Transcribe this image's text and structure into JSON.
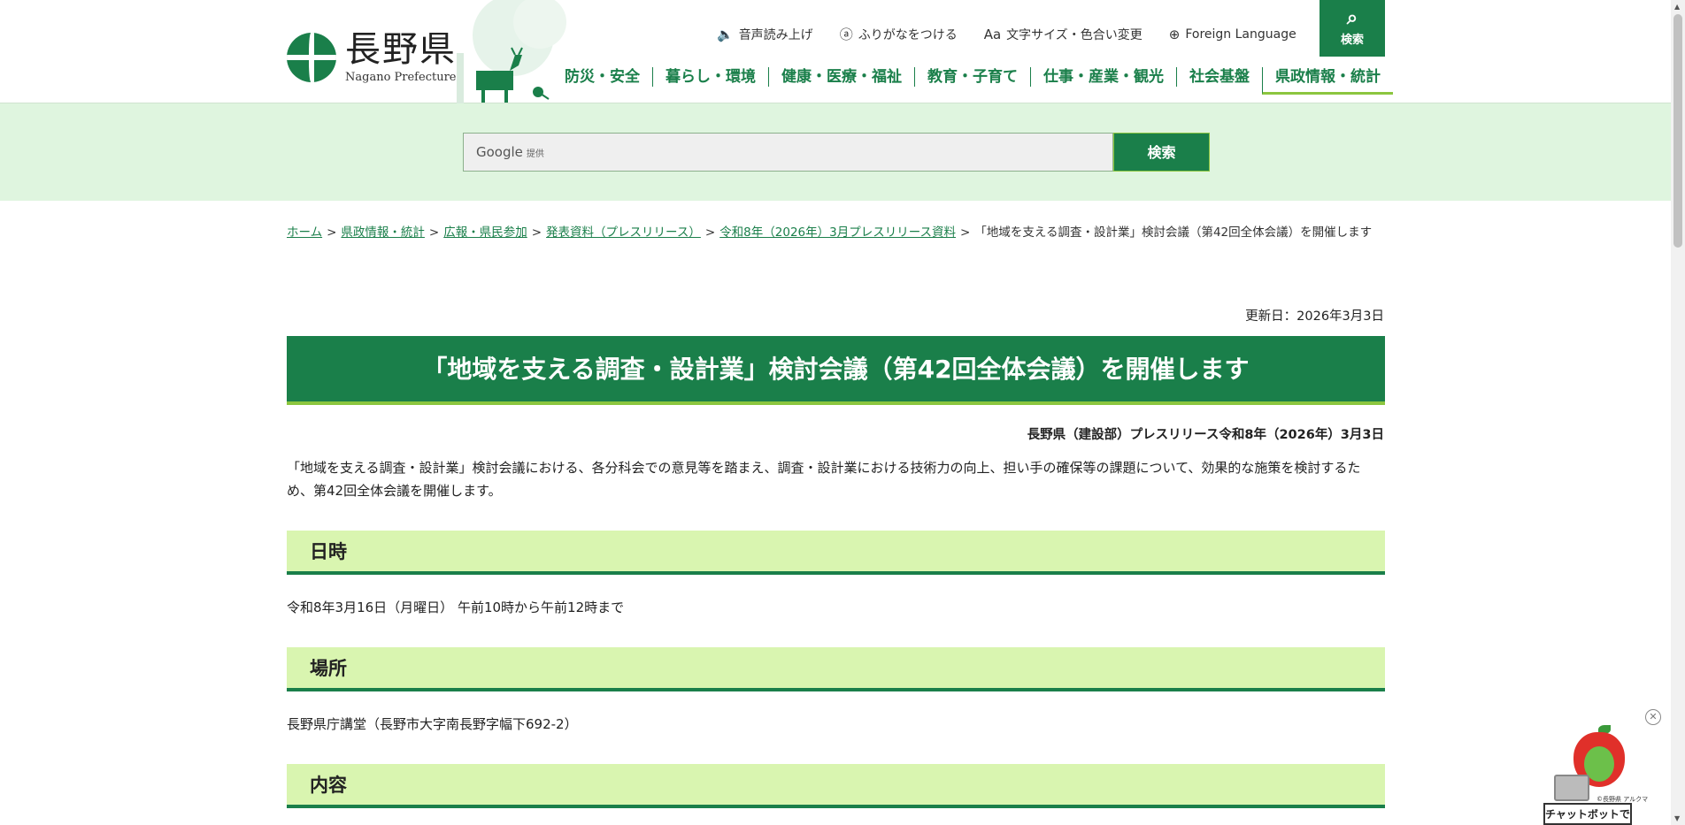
{
  "header": {
    "logo_jp": "長野県",
    "logo_en": "Nagano Prefecture",
    "utility": [
      {
        "label": "音声読み上げ",
        "icon": "speaker-icon"
      },
      {
        "label": "ふりがなをつける",
        "icon": "hiragana-icon"
      },
      {
        "label": "文字サイズ・色合い変更",
        "icon": "font-size-icon"
      },
      {
        "label": "Foreign Language",
        "icon": "globe-icon"
      }
    ],
    "search_label": "検索",
    "nav": [
      "防災・安全",
      "暮らし・環境",
      "健康・医療・福祉",
      "教育・子育て",
      "仕事・産業・観光",
      "社会基盤",
      "県政情報・統計"
    ]
  },
  "search": {
    "brand": "Google",
    "brand_suffix": "提供",
    "button": "検索"
  },
  "breadcrumb": {
    "links": [
      "ホーム",
      "県政情報・統計",
      "広報・県民参加",
      "発表資料（プレスリリース）",
      "令和8年（2026年）3月プレスリリース資料"
    ],
    "current": "「地域を支える調査・設計業」検討会議（第42回全体会議）を開催します"
  },
  "article": {
    "updated": "更新日：2026年3月3日",
    "title": "「地域を支える調査・設計業」検討会議（第42回全体会議）を開催します",
    "release": "長野県（建設部）プレスリリース令和8年（2026年）3月3日",
    "lead": "「地域を支える調査・設計業」検討会議における、各分科会での意見等を踏まえ、調査・設計業における技術力の向上、担い手の確保等の課題について、効果的な施策を検討するため、第42回全体会議を開催します。",
    "sections": [
      {
        "heading": "日時",
        "body": "令和8年3月16日（月曜日） 午前10時から午前12時まで"
      },
      {
        "heading": "場所",
        "body": "長野県庁講堂（長野市大字南長野字幅下692-2）"
      },
      {
        "heading": "内容",
        "body": ""
      }
    ]
  },
  "chatbot": {
    "credit": "©長野県 アルクマ",
    "label": "チャットボットで調べる"
  },
  "colors": {
    "primary": "#1a7f4a",
    "accent": "#8cc63f",
    "band": "#dff5df",
    "section": "#d9f5b0"
  }
}
